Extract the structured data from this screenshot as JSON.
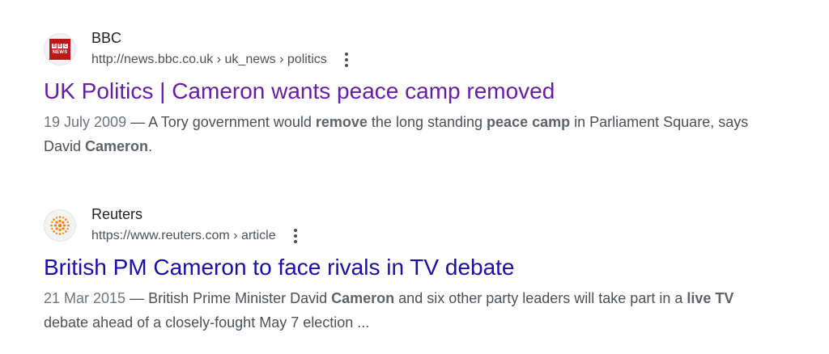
{
  "results": [
    {
      "site_name": "BBC",
      "url": "http://news.bbc.co.uk › uk_news › politics",
      "favicon": "bbc-news-icon",
      "favicon_text": {
        "blocks": [
          "B",
          "B",
          "C"
        ],
        "sub": "NEWS"
      },
      "title": "UK Politics | Cameron wants peace camp removed",
      "title_color": "#681da8",
      "snippet": {
        "date": "19 July 2009",
        "sep": " — ",
        "p1": "A Tory government would ",
        "b1": "remove",
        "p2": " the long standing ",
        "b2": "peace camp",
        "p3": " in Parliament Square, says David ",
        "b3": "Cameron",
        "p4": "."
      }
    },
    {
      "site_name": "Reuters",
      "url": "https://www.reuters.com › article",
      "favicon": "reuters-icon",
      "title": "British PM Cameron to face rivals in TV debate",
      "title_color": "#1a0dab",
      "snippet": {
        "date": "21 Mar 2015",
        "sep": " — ",
        "p1": "British Prime Minister David ",
        "b1": "Cameron",
        "p2": " and six other party leaders will take part in a ",
        "b2": "live TV",
        "p3": " debate ahead of a closely-fought May 7 election ..."
      }
    }
  ],
  "colors": {
    "visited_link": "#681da8",
    "link": "#1a0dab",
    "snippet_text": "#4d5156",
    "bbc_red": "#bb1919",
    "reuters_orange": "#ff8000"
  }
}
